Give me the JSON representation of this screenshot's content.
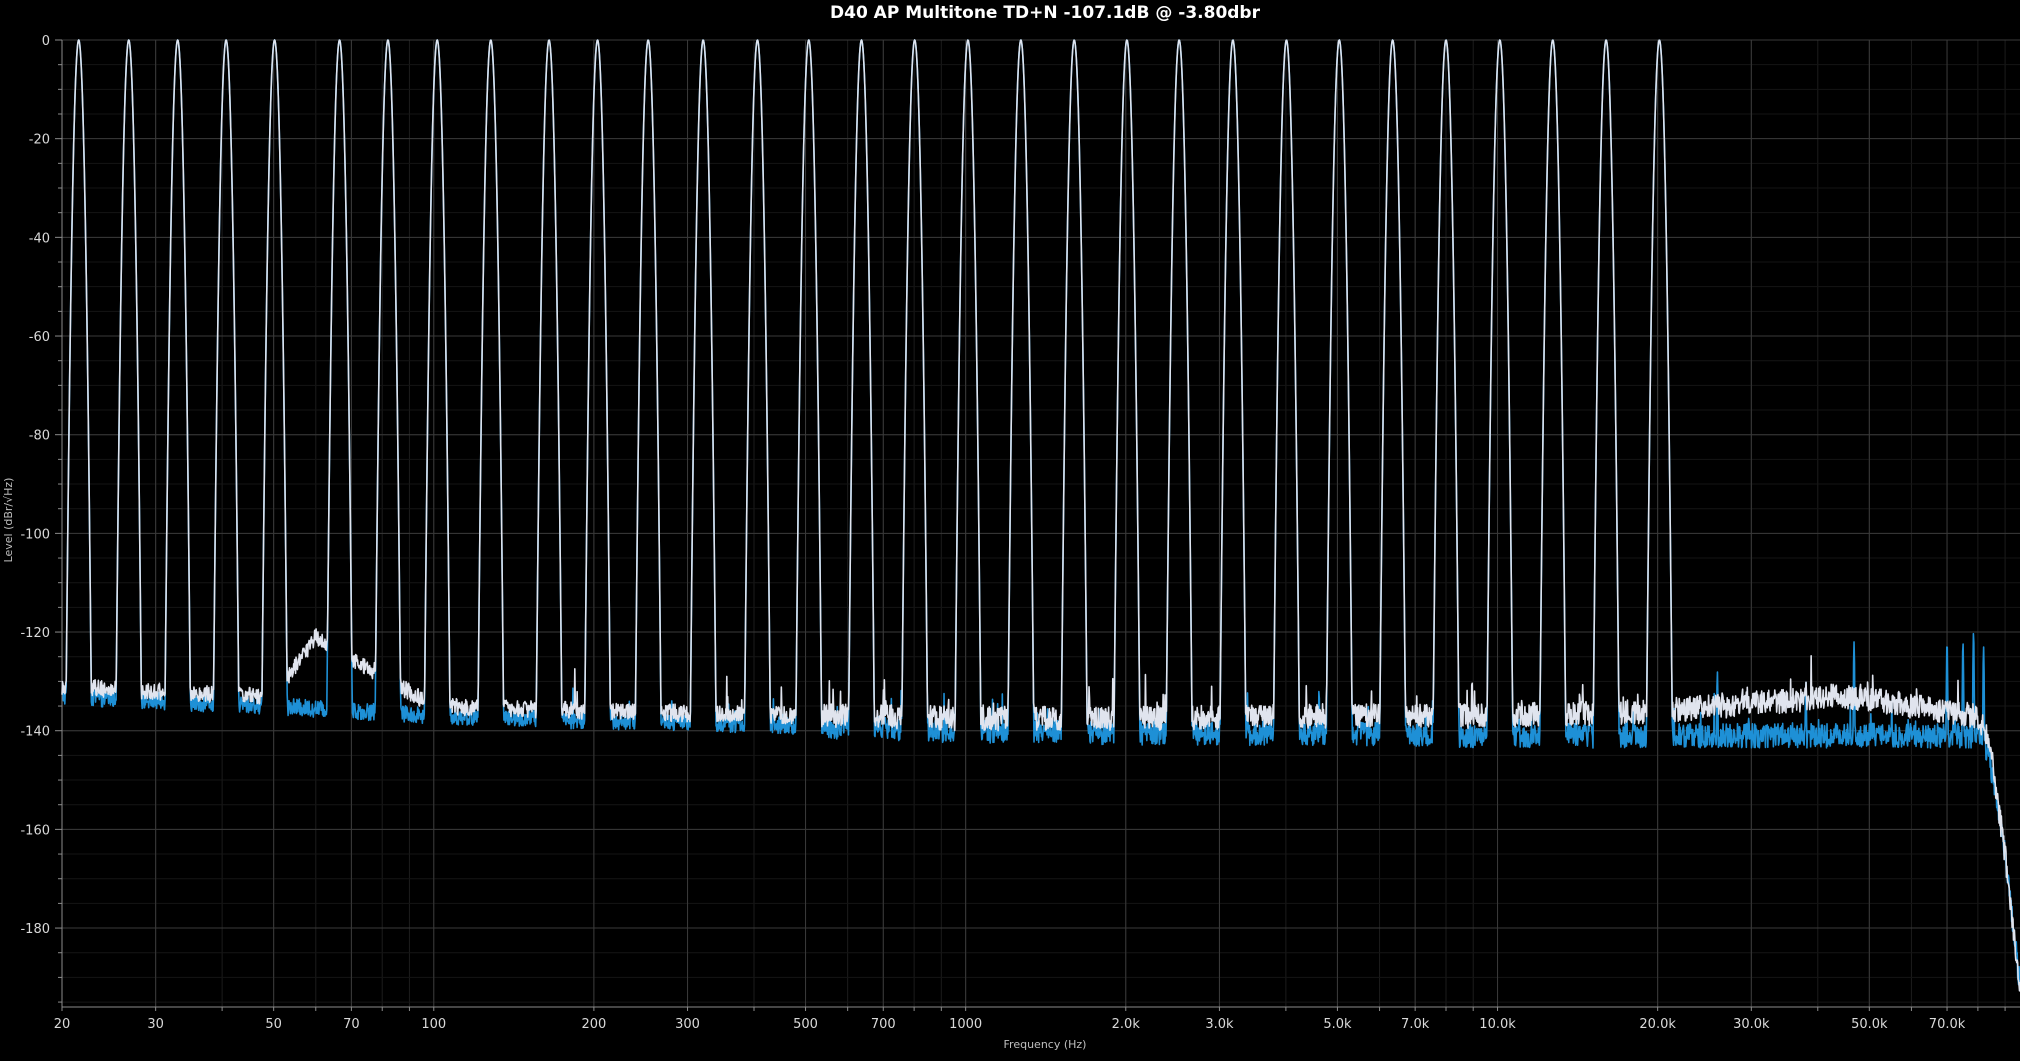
{
  "chart_data": {
    "type": "line",
    "title": "D40 AP Multitone TD+N -107.1dB @ -3.80dbr",
    "xlabel": "Frequency (Hz)",
    "ylabel": "Level (dBr/√Hz)",
    "x_scale": "log",
    "xlim": [
      20,
      96000
    ],
    "ylim": [
      -196,
      0
    ],
    "grid": true,
    "legend": "none",
    "x_ticks": [
      {
        "value": 20,
        "label": "20"
      },
      {
        "value": 30,
        "label": "30"
      },
      {
        "value": 50,
        "label": "50"
      },
      {
        "value": 70,
        "label": "70"
      },
      {
        "value": 100,
        "label": "100"
      },
      {
        "value": 200,
        "label": "200"
      },
      {
        "value": 300,
        "label": "300"
      },
      {
        "value": 500,
        "label": "500"
      },
      {
        "value": 700,
        "label": "700"
      },
      {
        "value": 1000,
        "label": "1000"
      },
      {
        "value": 2000,
        "label": "2.0k"
      },
      {
        "value": 3000,
        "label": "3.0k"
      },
      {
        "value": 5000,
        "label": "5.0k"
      },
      {
        "value": 7000,
        "label": "7.0k"
      },
      {
        "value": 10000,
        "label": "10.0k"
      },
      {
        "value": 20000,
        "label": "20.0k"
      },
      {
        "value": 30000,
        "label": "30.0k"
      },
      {
        "value": 50000,
        "label": "50.0k"
      },
      {
        "value": 70000,
        "label": "70.0k"
      }
    ],
    "y_ticks": [
      {
        "value": 0,
        "label": "0"
      },
      {
        "value": -20,
        "label": "-20"
      },
      {
        "value": -40,
        "label": "-40"
      },
      {
        "value": -60,
        "label": "-60"
      },
      {
        "value": -80,
        "label": "-80"
      },
      {
        "value": -100,
        "label": "-100"
      },
      {
        "value": -120,
        "label": "-120"
      },
      {
        "value": -140,
        "label": "-140"
      },
      {
        "value": -160,
        "label": "-160"
      },
      {
        "value": -180,
        "label": "-180"
      }
    ],
    "series": [
      {
        "color": "#1e90d6",
        "tone_frequencies": [
          21.5,
          26.7,
          33.0,
          40.7,
          50.2,
          66.5,
          82.0,
          101.5,
          128.0,
          164.7,
          203.2,
          253.0,
          321.0,
          406.0,
          507.0,
          637.0,
          802.0,
          1010.0,
          1270.0,
          1600.0,
          2010.0,
          2520.0,
          3180.0,
          4010.0,
          5040.0,
          6350.0,
          8000.0,
          10100.0,
          12700.0,
          16000.0,
          20150.0
        ],
        "tone_peak_db": 0,
        "noise_floor": [
          [
            20,
            -133
          ],
          [
            30,
            -134
          ],
          [
            50,
            -135
          ],
          [
            100,
            -137
          ],
          [
            200,
            -138
          ],
          [
            500,
            -139
          ],
          [
            1000,
            -140
          ],
          [
            2000,
            -140.5
          ],
          [
            5000,
            -140.5
          ],
          [
            10000,
            -141
          ],
          [
            20000,
            -141
          ],
          [
            45000,
            -141
          ],
          [
            80000,
            -141
          ],
          [
            84000,
            -145
          ],
          [
            90000,
            -165
          ],
          [
            96000,
            -192
          ]
        ],
        "spurs": [
          [
            6450,
            -126
          ],
          [
            12900,
            -127
          ],
          [
            25900,
            -128
          ],
          [
            38000,
            -130
          ],
          [
            46800,
            -122
          ],
          [
            70000,
            -122
          ],
          [
            75000,
            -122
          ],
          [
            78500,
            -120
          ],
          [
            82000,
            -123
          ]
        ]
      },
      {
        "color": "#e0e4ee",
        "tone_frequencies": [
          21.5,
          26.7,
          33.0,
          40.7,
          50.2,
          66.5,
          82.0,
          101.5,
          128.0,
          164.7,
          203.2,
          253.0,
          321.0,
          406.0,
          507.0,
          637.0,
          802.0,
          1010.0,
          1270.0,
          1600.0,
          2010.0,
          2520.0,
          3180.0,
          4010.0,
          5040.0,
          6350.0,
          8000.0,
          10100.0,
          12700.0,
          16000.0,
          20150.0
        ],
        "tone_peak_db": 0,
        "noise_floor": [
          [
            20,
            -131
          ],
          [
            30,
            -132
          ],
          [
            50,
            -133
          ],
          [
            60,
            -121
          ],
          [
            100,
            -135
          ],
          [
            200,
            -136
          ],
          [
            500,
            -137
          ],
          [
            1000,
            -137.5
          ],
          [
            2000,
            -137.5
          ],
          [
            5000,
            -137
          ],
          [
            10000,
            -137
          ],
          [
            20000,
            -136
          ],
          [
            45000,
            -133
          ],
          [
            80000,
            -137
          ],
          [
            84000,
            -142
          ],
          [
            90000,
            -165
          ],
          [
            96000,
            -192
          ]
        ],
        "spurs": [
          [
            60,
            -121
          ],
          [
            20100,
            -131
          ],
          [
            38000,
            -130
          ],
          [
            46800,
            -132
          ]
        ]
      }
    ]
  }
}
